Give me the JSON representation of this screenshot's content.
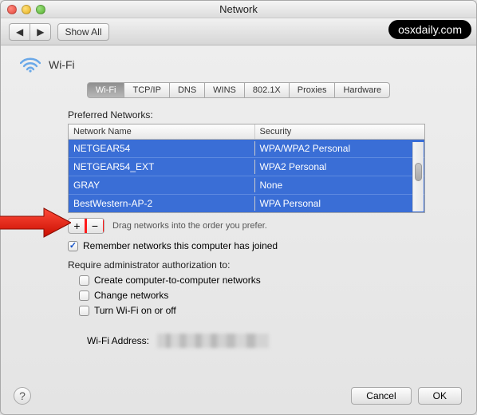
{
  "window_title": "Network",
  "toolbar": {
    "show_all": "Show All"
  },
  "watermark": "osxdaily.com",
  "header": {
    "title": "Wi-Fi"
  },
  "tabs": [
    "Wi-Fi",
    "TCP/IP",
    "DNS",
    "WINS",
    "802.1X",
    "Proxies",
    "Hardware"
  ],
  "preferred_label": "Preferred Networks:",
  "columns": {
    "name": "Network Name",
    "security": "Security"
  },
  "networks": [
    {
      "name": "NETGEAR54",
      "security": "WPA/WPA2 Personal"
    },
    {
      "name": "NETGEAR54_EXT",
      "security": "WPA2 Personal"
    },
    {
      "name": "GRAY",
      "security": "None"
    },
    {
      "name": "BestWestern-AP-2",
      "security": "WPA Personal"
    }
  ],
  "drag_hint": "Drag networks into the order you prefer.",
  "remember_label": "Remember networks this computer has joined",
  "require_label": "Require administrator authorization to:",
  "opts": {
    "create": "Create computer-to-computer networks",
    "change": "Change networks",
    "turn": "Turn Wi-Fi on or off"
  },
  "wifi_addr_label": "Wi-Fi Address:",
  "buttons": {
    "cancel": "Cancel",
    "ok": "OK"
  },
  "add_symbol": "+",
  "remove_symbol": "−",
  "help_symbol": "?"
}
